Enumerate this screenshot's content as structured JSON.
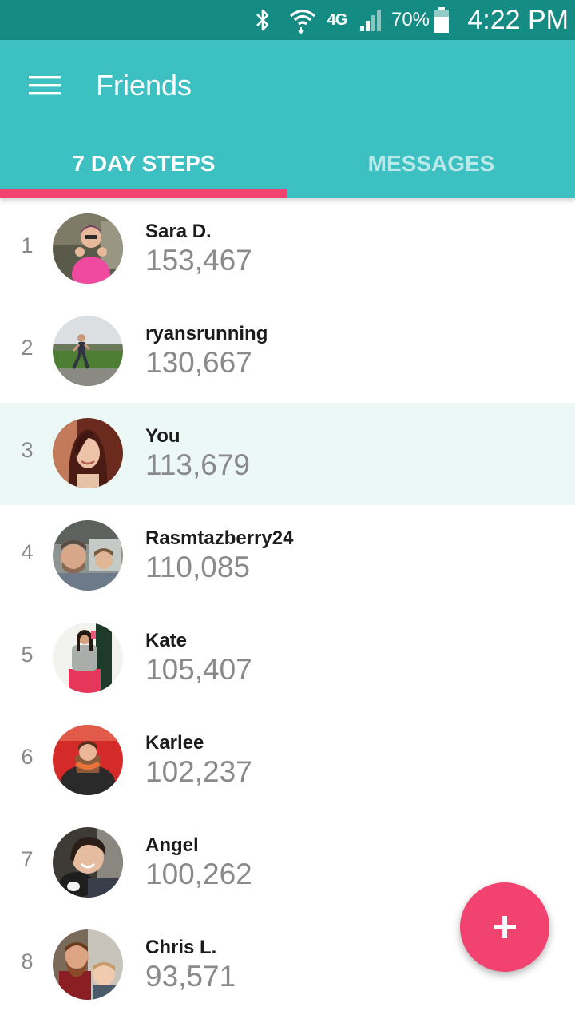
{
  "status_bar": {
    "network": "4G",
    "battery_percent": "70%",
    "time": "4:22 PM",
    "icons": [
      "bluetooth-icon",
      "wifi-icon",
      "signal-icon",
      "battery-icon"
    ]
  },
  "header": {
    "title": "Friends",
    "menu_icon": "hamburger-menu-icon"
  },
  "tabs": [
    {
      "label": "7 DAY STEPS",
      "active": true
    },
    {
      "label": "MESSAGES",
      "active": false
    }
  ],
  "colors": {
    "status_bar": "#148c83",
    "app_bar": "#3cc0c2",
    "accent": "#f2426f",
    "highlight_row": "#ecf8f5"
  },
  "leaderboard": [
    {
      "rank": "1",
      "name": "Sara D.",
      "steps": "153,467"
    },
    {
      "rank": "2",
      "name": "ryansrunning",
      "steps": "130,667"
    },
    {
      "rank": "3",
      "name": "You",
      "steps": "113,679",
      "highlighted": true
    },
    {
      "rank": "4",
      "name": "Rasmtazberry24",
      "steps": "110,085"
    },
    {
      "rank": "5",
      "name": "Kate",
      "steps": "105,407"
    },
    {
      "rank": "6",
      "name": "Karlee",
      "steps": "102,237"
    },
    {
      "rank": "7",
      "name": "Angel",
      "steps": "100,262"
    },
    {
      "rank": "8",
      "name": "Chris L.",
      "steps": "93,571"
    }
  ],
  "fab": {
    "icon": "plus-icon"
  }
}
